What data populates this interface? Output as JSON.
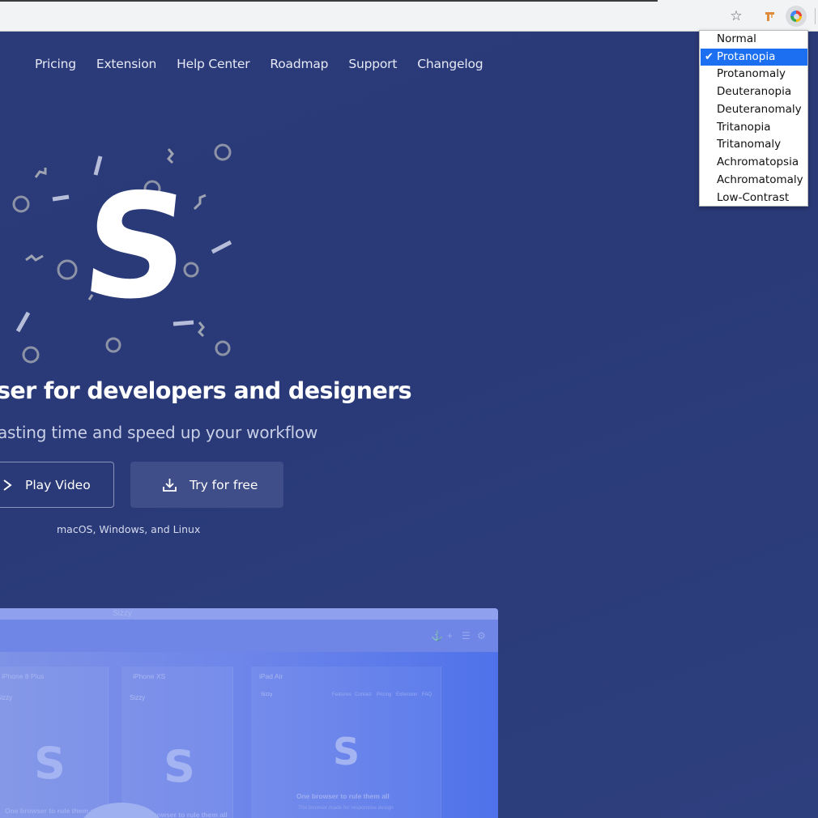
{
  "toolbar": {
    "icons": [
      "star-icon",
      "extension-icon",
      "colorblindly-icon"
    ]
  },
  "nav": {
    "items": [
      "Pricing",
      "Extension",
      "Help Center",
      "Roadmap",
      "Support",
      "Changelog"
    ]
  },
  "logo": {
    "letter": "S"
  },
  "hero": {
    "title": "ser for developers and designers",
    "subtitle": "asting time and speed up your workflow",
    "play_video_label": "Play Video",
    "try_free_label": "Try for free",
    "platforms": "macOS, Windows, and Linux"
  },
  "preview": {
    "window_title": "Sizzy",
    "devices": [
      "iPhone 8 Plus",
      "iPhone XS",
      "iPad Air"
    ],
    "app_name": "Sizzy",
    "headline": "One browser to rule them all",
    "subline": "The browser made for responsive design",
    "nav": [
      "Features",
      "Contact",
      "Pricing",
      "Extension",
      "FAQ"
    ]
  },
  "dropdown": {
    "selected": "Protanopia",
    "options": [
      "Normal",
      "Protanopia",
      "Protanomaly",
      "Deuteranopia",
      "Deuteranomaly",
      "Tritanopia",
      "Tritanomaly",
      "Achromatopsia",
      "Achromatomaly",
      "Low-Contrast"
    ]
  },
  "colors": {
    "background": "#2b3a78",
    "selected_item": "#1b6ff0",
    "try_button": "#3f4d89",
    "preview_accent": "#4f72ea"
  }
}
